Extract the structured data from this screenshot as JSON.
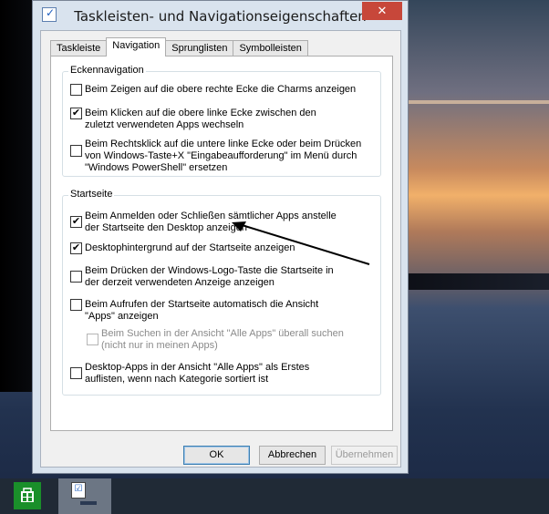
{
  "window": {
    "title": "Taskleisten- und Navigationseigenschaften",
    "close_symbol": "✕"
  },
  "tabs": [
    {
      "label": "Taskleiste",
      "active": false
    },
    {
      "label": "Navigation",
      "active": true
    },
    {
      "label": "Sprunglisten",
      "active": false
    },
    {
      "label": "Symbolleisten",
      "active": false
    }
  ],
  "groups": {
    "corner": {
      "title": "Eckennavigation",
      "options": [
        {
          "label": "Beim Zeigen auf die obere rechte Ecke die Charms anzeigen",
          "checked": false
        },
        {
          "label": "Beim Klicken auf die obere linke Ecke zwischen den zuletzt verwendeten Apps wechseln",
          "checked": true
        },
        {
          "label": "Beim Rechtsklick auf die untere linke Ecke oder beim Drücken von Windows-Taste+X \"Eingabeaufforderung\" im Menü durch \"Windows PowerShell\" ersetzen",
          "checked": false
        }
      ]
    },
    "start": {
      "title": "Startseite",
      "options": [
        {
          "label": "Beim Anmelden oder Schließen sämtlicher Apps anstelle der Startseite den Desktop anzeigen",
          "checked": true
        },
        {
          "label": "Desktophintergrund auf der Startseite anzeigen",
          "checked": true
        },
        {
          "label": "Beim Drücken der Windows-Logo-Taste die Startseite in der derzeit verwendeten Anzeige anzeigen",
          "checked": false
        },
        {
          "label": "Beim Aufrufen der Startseite automatisch die Ansicht \"Apps\" anzeigen",
          "checked": false
        },
        {
          "label": "Beim Suchen in der Ansicht \"Alle Apps\" überall suchen (nicht nur in meinen Apps)",
          "checked": false,
          "disabled": true
        },
        {
          "label": "Desktop-Apps in der Ansicht \"Alle Apps\" als Erstes auflisten, wenn nach Kategorie sortiert ist",
          "checked": false
        }
      ]
    }
  },
  "buttons": {
    "ok": "OK",
    "cancel": "Abbrechen",
    "apply": "Übernehmen"
  },
  "check_glyph": "✔",
  "taskbar": {
    "start_icon": "store-tile-icon",
    "item_icon": "taskbar-properties-icon"
  }
}
